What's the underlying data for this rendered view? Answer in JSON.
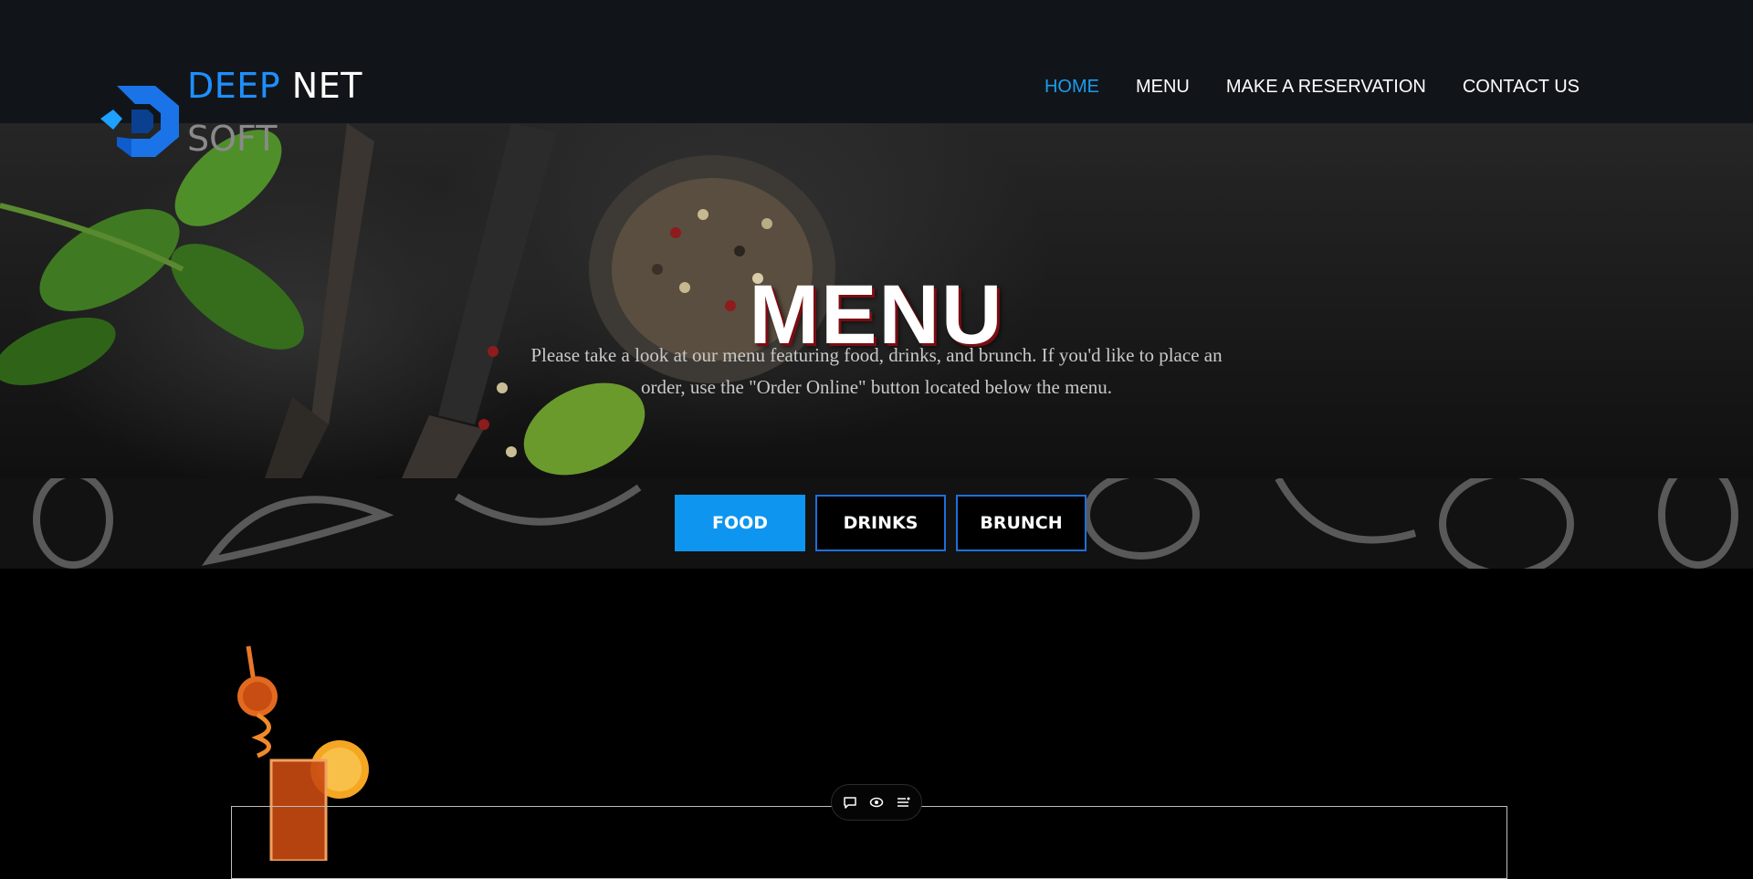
{
  "brand": {
    "word1": "DEEP",
    "word2": "NET",
    "word3": "SOFT",
    "accent": "#1f8fff"
  },
  "nav": {
    "home": "HOME",
    "menu": "MENU",
    "reservation": "MAKE A RESERVATION",
    "contact": "CONTACT US",
    "active_color": "#1b9cf0"
  },
  "hero": {
    "title": "MENU",
    "description": "Please take a look at our menu featuring food, drinks, and brunch. If you'd like to place an order, use the \"Order Online\" button located below the menu."
  },
  "tabs": {
    "food": "FOOD",
    "drinks": "DRINKS",
    "brunch": "BRUNCH",
    "active": "FOOD",
    "active_color": "#0d95f0",
    "border_color": "#1f6fd9"
  },
  "toolbar": {
    "icons": [
      "comment-icon",
      "eye-icon",
      "list-icon"
    ]
  }
}
